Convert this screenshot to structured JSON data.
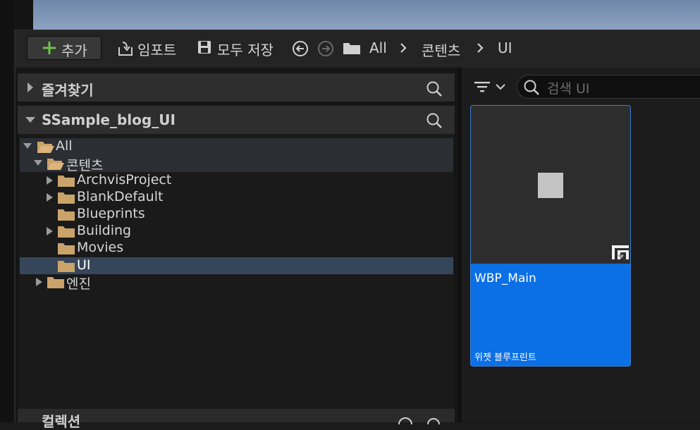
{
  "toolbar": {
    "add_label": "추가",
    "import_label": "임포트",
    "save_all_label": "모두 저장",
    "breadcrumb": [
      "All",
      "콘텐츠",
      "UI"
    ]
  },
  "sections": {
    "favorites": "즐겨찾기",
    "project": "SSample_blog_UI",
    "collections": "컬렉션"
  },
  "tree": [
    {
      "label": "All"
    },
    {
      "label": "콘텐츠"
    },
    {
      "label": "ArchvisProject"
    },
    {
      "label": "BlankDefault"
    },
    {
      "label": "Blueprints"
    },
    {
      "label": "Building"
    },
    {
      "label": "Movies"
    },
    {
      "label": "UI"
    },
    {
      "label": "엔진"
    }
  ],
  "search": {
    "placeholder": "검색 UI"
  },
  "asset": {
    "name": "WBP_Main",
    "type": "위젯 블루프린트"
  },
  "colors": {
    "accent": "#0b6fe6",
    "add_green": "#6fc24a",
    "folder": "#c9a36a",
    "selection": "#36465a"
  }
}
